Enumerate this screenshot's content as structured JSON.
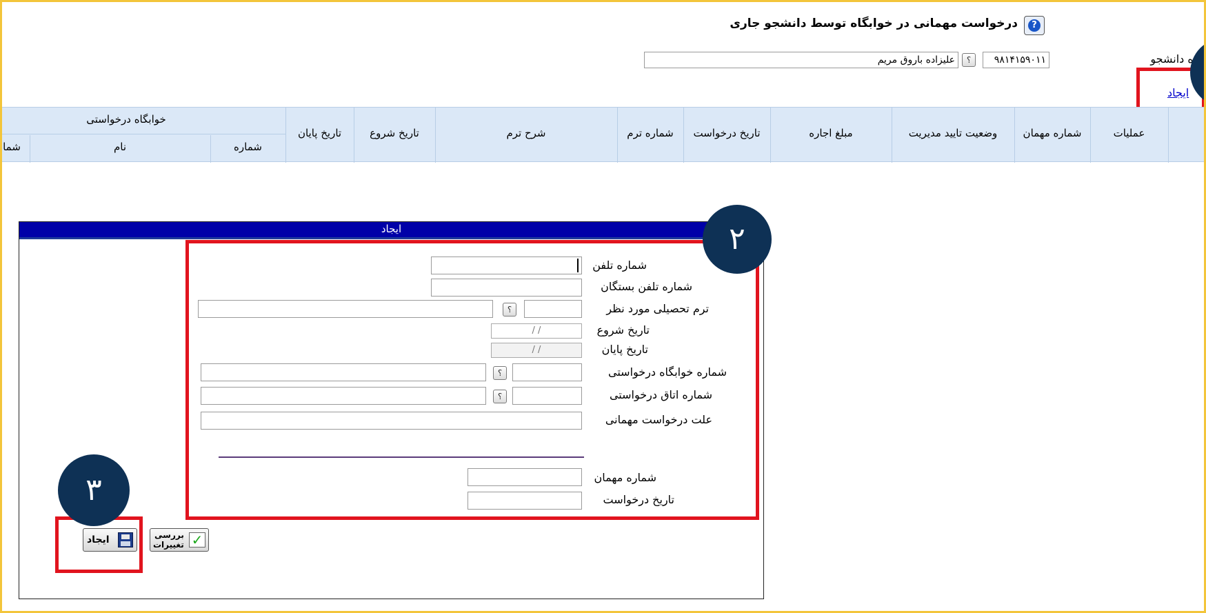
{
  "page": {
    "title": "درخواست مهمانی در خوابگاه توسط دانشجو جاری",
    "student_number_label": "شماره دانشجو",
    "student_number": "۹۸۱۴۱۵۹۰۱۱",
    "student_name": "علیزاده باروق مریم",
    "create_link": "ایجاد"
  },
  "table": {
    "columns": [
      "عملیات",
      "شماره مهمان",
      "وضعیت تایید مدیریت",
      "مبلغ اجاره",
      "تاریخ درخواست",
      "شماره ترم",
      "شرح ترم",
      "تاریخ شروع",
      "تاریخ پایان"
    ],
    "group_header": "خوابگاه درخواستی",
    "sub_columns": [
      "شماره",
      "نام",
      "شما"
    ]
  },
  "form": {
    "title": "ایجاد",
    "fields": {
      "phone": "شماره تلفن",
      "relatives_phone": "شماره تلفن بستگان",
      "term": "ترم تحصیلی مورد نظر",
      "start_date": "تاریخ شروع",
      "end_date": "تاریخ پایان",
      "dorm_number": "شماره خوابگاه درخواستی",
      "room_number": "شماره اتاق درخواستی",
      "reason": "علت درخواست مهمانی",
      "guest_number": "شماره مهمان",
      "request_date": "تاریخ درخواست"
    },
    "date_placeholder": "/     /",
    "lookup": "؟",
    "create_button": "ایجاد",
    "review_button_line1": "بررسی",
    "review_button_line2": "تغییرات"
  },
  "annotations": {
    "badge2": "۲",
    "badge3": "۳"
  },
  "colors": {
    "frame_border": "#f3c53a",
    "form_title_bar": "#0000a8",
    "annotation_red": "#e1141e",
    "badge_navy": "#0e3155",
    "header_bg": "#dbe8f7"
  }
}
